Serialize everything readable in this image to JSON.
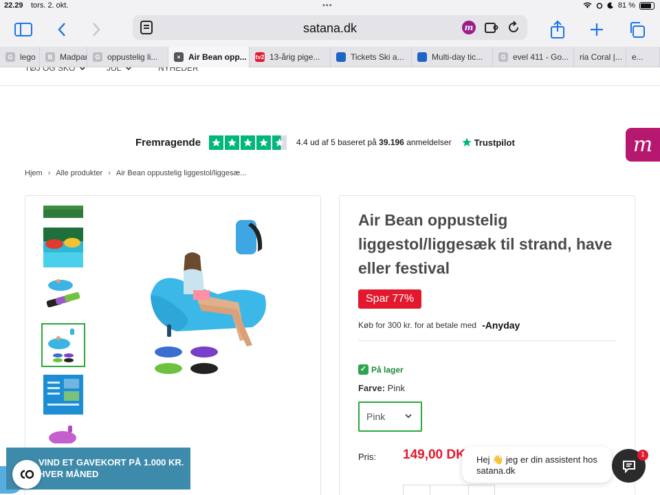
{
  "status": {
    "time": "22.29",
    "date": "tors. 2. okt.",
    "battery": "81 %",
    "battery_level": 0.81
  },
  "toolbar": {
    "domain": "satana.dk",
    "extension_badge": "m"
  },
  "tabs": [
    {
      "label": "lego",
      "fav": "G",
      "fav_color": "#bdbdc2"
    },
    {
      "label": "Madpar",
      "fav": "B",
      "fav_color": "#bdbdc2"
    },
    {
      "label": "oppustelig li...",
      "fav": "G",
      "fav_color": "#bdbdc2"
    },
    {
      "label": "Air Bean opp...",
      "fav": "×",
      "fav_color": "#555555",
      "active": true
    },
    {
      "label": "13-årig pige...",
      "fav": "tv2",
      "fav_color": "#e3182d"
    },
    {
      "label": "Tickets Ski a...",
      "fav": "",
      "fav_color": "#1f63c4"
    },
    {
      "label": "Multi-day tic...",
      "fav": "",
      "fav_color": "#1f63c4"
    },
    {
      "label": "evel 411 - Go...",
      "fav": "G",
      "fav_color": "#bdbdc2"
    },
    {
      "label": "ria Coral |...",
      "fav": "",
      "fav_color": ""
    },
    {
      "label": "e...",
      "fav": "",
      "fav_color": ""
    }
  ],
  "nav": {
    "items": [
      "TØJ OG SKO",
      "JUL",
      "NYHEDER"
    ]
  },
  "trustpilot": {
    "label": "Fremragende",
    "rating_text": "4.4 ud af 5 baseret på",
    "reviews": "39.196",
    "reviews_suffix": "anmeldelser",
    "brand": "Trustpilot",
    "rating": 4.4
  },
  "side_widget": {
    "letter": "m"
  },
  "breadcrumb": [
    "Hjem",
    "Alle produkter",
    "Air Bean oppustelig liggestol/liggesæ..."
  ],
  "product": {
    "title": "Air Bean oppustelig liggestol/liggesæk til strand, have eller festival",
    "save_badge": "Spar 77%",
    "anyday_text": "Køb for 300 kr. for at betale med",
    "anyday_logo": "-Anyday",
    "stock": "På lager",
    "color_label": "Farve:",
    "color_value": "Pink",
    "select_value": "Pink",
    "price_label": "Pris:",
    "price": "149,00 DK"
  },
  "promo": {
    "line1": "VIND ET GAVEKORT PÅ 1.000 KR.",
    "line2": "HVER MÅNED"
  },
  "chat": {
    "line1": "Hej 👋 jeg er din assistent hos",
    "line2": "satana.dk",
    "badge": "1"
  },
  "colors": {
    "accent": "#1a73e8",
    "sale": "#e3182d",
    "trustpilot": "#00b67a",
    "instock": "#2aa63a",
    "promo": "#3d8aab",
    "brand_m": "#b6176f"
  }
}
